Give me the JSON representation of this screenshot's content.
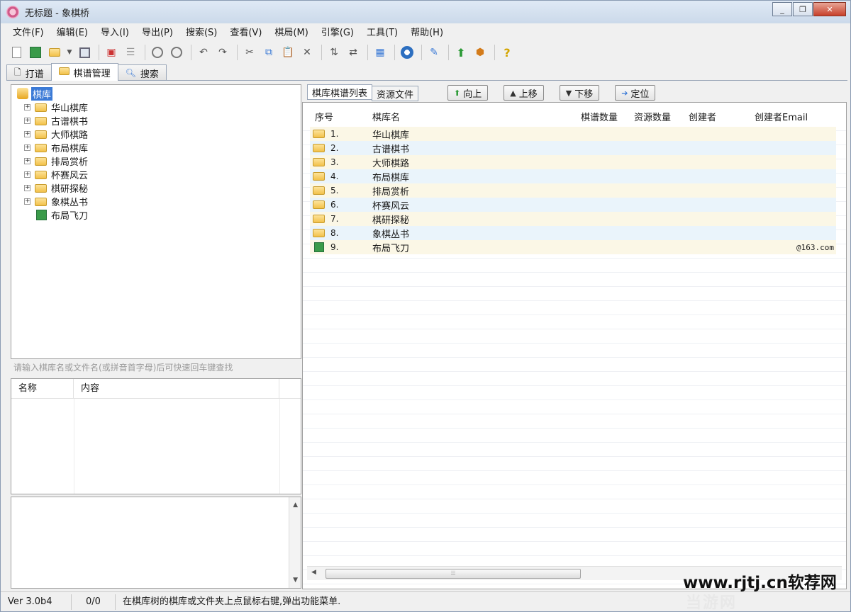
{
  "window": {
    "title": "无标题 - 象棋桥",
    "controls": [
      "minimize",
      "maximize",
      "close"
    ]
  },
  "menu": [
    "文件(F)",
    "编辑(E)",
    "导入(I)",
    "导出(P)",
    "搜索(S)",
    "查看(V)",
    "棋局(M)",
    "引擎(G)",
    "工具(T)",
    "帮助(H)"
  ],
  "tabs": [
    {
      "label": "打谱",
      "icon": "page-icon"
    },
    {
      "label": "棋谱管理",
      "icon": "folder-icon",
      "active": true
    },
    {
      "label": "搜索",
      "icon": "magnifier-icon"
    }
  ],
  "tree": {
    "root": "棋库",
    "items": [
      {
        "label": "华山棋库",
        "type": "folder"
      },
      {
        "label": "古谱棋书",
        "type": "folder"
      },
      {
        "label": "大师棋路",
        "type": "folder"
      },
      {
        "label": "布局棋库",
        "type": "folder"
      },
      {
        "label": "排局赏析",
        "type": "folder"
      },
      {
        "label": "杯赛风云",
        "type": "folder"
      },
      {
        "label": "棋研探秘",
        "type": "folder"
      },
      {
        "label": "象棋丛书",
        "type": "folder"
      },
      {
        "label": "布局飞刀",
        "type": "book"
      }
    ]
  },
  "search_hint": "请输入棋库名或文件名(或拼音首字母)后可快速回车键查找",
  "properties": {
    "col_name": "名称",
    "col_content": "内容"
  },
  "right_panel": {
    "tabs": [
      "棋库棋谱列表",
      "资源文件"
    ],
    "buttons": [
      "向上",
      "上移",
      "下移",
      "定位"
    ],
    "columns": {
      "index": "序号",
      "name": "棋库名",
      "games": "棋谱数量",
      "resources": "资源数量",
      "creator": "创建者",
      "creator_email": "创建者Email"
    },
    "rows": [
      {
        "num": "1.",
        "name": "华山棋库",
        "type": "folder",
        "email": ""
      },
      {
        "num": "2.",
        "name": "古谱棋书",
        "type": "folder",
        "email": ""
      },
      {
        "num": "3.",
        "name": "大师棋路",
        "type": "folder",
        "email": ""
      },
      {
        "num": "4.",
        "name": "布局棋库",
        "type": "folder",
        "email": ""
      },
      {
        "num": "5.",
        "name": "排局赏析",
        "type": "folder",
        "email": ""
      },
      {
        "num": "6.",
        "name": "杯赛风云",
        "type": "folder",
        "email": ""
      },
      {
        "num": "7.",
        "name": "棋研探秘",
        "type": "folder",
        "email": ""
      },
      {
        "num": "8.",
        "name": "象棋丛书",
        "type": "folder",
        "email": ""
      },
      {
        "num": "9.",
        "name": "布局飞刀",
        "type": "book",
        "email": "@163.com"
      }
    ]
  },
  "status": {
    "version": "Ver 3.0b4",
    "count": "0/0",
    "message": "在棋库树的棋库或文件夹上点鼠标右键,弹出功能菜单."
  },
  "watermark": {
    "url": "www.rjtj.cn软荐网",
    "brand": "当游网"
  },
  "colors": {
    "selection": "#3b7ad6",
    "row_odd": "#fbf7e6",
    "row_even": "#eaf4fb",
    "folder": "#f2c14a",
    "book": "#3a9b4a"
  }
}
